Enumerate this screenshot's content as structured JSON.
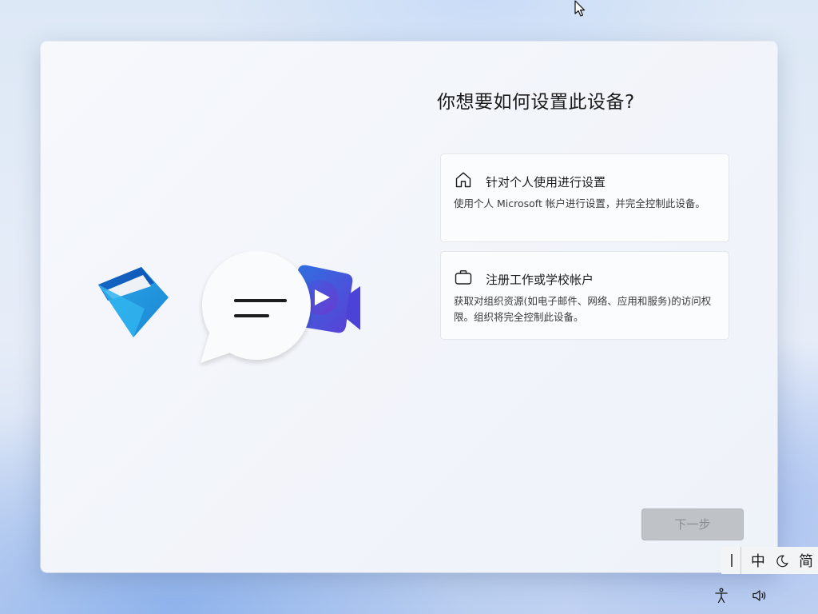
{
  "dialog": {
    "title": "你想要如何设置此设备?",
    "options": [
      {
        "icon": "home-icon",
        "title": "针对个人使用进行设置",
        "description": "使用个人 Microsoft 帐户进行设置，并完全控制此设备。"
      },
      {
        "icon": "briefcase-icon",
        "title": "注册工作或学校帐户",
        "description": "获取对组织资源(如电子邮件、网络、应用和服务)的访问权限。组织将完全控制此设备。"
      }
    ],
    "next_button": "下一步",
    "next_enabled": false
  },
  "illustration": {
    "icons": [
      "mail-icon",
      "chat-bubble-icon",
      "video-call-icon"
    ]
  },
  "ime_bar": {
    "mode": "中",
    "moon_icon": "moon-icon",
    "charset": "简"
  },
  "tray": {
    "icons": [
      "accessibility-icon",
      "volume-icon"
    ]
  },
  "colors": {
    "mail_blue": "#1c8fd6",
    "video_purple": "#5a48d8",
    "button_disabled": "#bfc3c8"
  }
}
